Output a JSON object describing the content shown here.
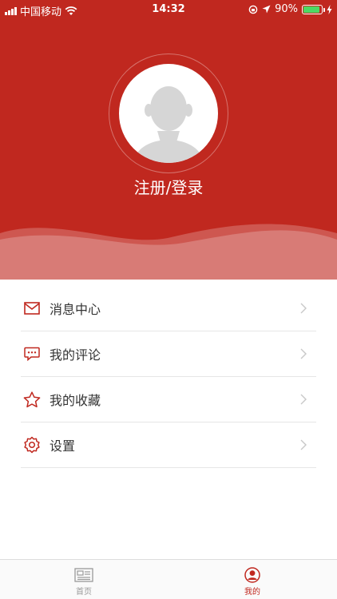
{
  "status_bar": {
    "carrier": "中国移动",
    "time": "14:32",
    "battery": "90%"
  },
  "profile": {
    "login_label": "注册/登录"
  },
  "menu": {
    "items": [
      {
        "label": "消息中心",
        "icon": "mail-icon"
      },
      {
        "label": "我的评论",
        "icon": "comment-icon"
      },
      {
        "label": "我的收藏",
        "icon": "star-icon"
      },
      {
        "label": "设置",
        "icon": "gear-icon"
      }
    ]
  },
  "tabbar": {
    "tabs": [
      {
        "label": "首页",
        "icon": "news-icon",
        "active": false
      },
      {
        "label": "我的",
        "icon": "user-icon",
        "active": true
      }
    ]
  },
  "colors": {
    "brand": "#c0281f",
    "active_tab": "#c0281f",
    "inactive_tab": "#999999",
    "battery": "#4cd964"
  }
}
